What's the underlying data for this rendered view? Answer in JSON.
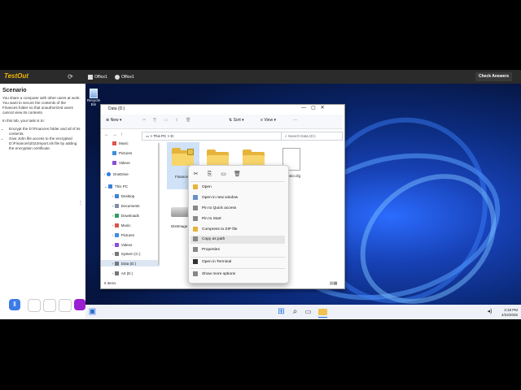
{
  "app": {
    "logo": "TestOut",
    "tabs": [
      {
        "label": "Office1"
      },
      {
        "label": "Office1"
      }
    ],
    "check_answers": "Check Answers"
  },
  "scenario": {
    "title": "Scenario",
    "intro": "You share a computer with other users at work. You want to secure the contents of the Finances folder so that unauthorized users cannot view its contents.",
    "task_lead": "In this lab, your task is to:",
    "tasks": [
      "Encrypt the D:\\Finances folder and all of its contents.",
      "Give John file access to the encrypted D:\\Finances\\2022report.xls file by adding the encryption certificate."
    ]
  },
  "desktop": {
    "recycle_bin": "Recycle Bin"
  },
  "explorer": {
    "title": "Data (D:)",
    "toolbar": {
      "new": "New",
      "sort": "Sort",
      "view": "View",
      "more": "···"
    },
    "address": {
      "root": "This PC",
      "sep": ">",
      "drive": "D:"
    },
    "search_placeholder": "Search Data (D:)",
    "sidebar": [
      {
        "label": "Music",
        "icon": "music-icon",
        "color": "#e0524b"
      },
      {
        "label": "Pictures",
        "icon": "pictures-icon",
        "color": "#3c8fe0"
      },
      {
        "label": "Videos",
        "icon": "videos-icon",
        "color": "#8a4fd8"
      },
      {
        "label": "OneDrive",
        "icon": "onedrive-icon",
        "color": "#2f7de1"
      },
      {
        "label": "This PC",
        "icon": "pc-icon",
        "color": "#3b82d6"
      },
      {
        "label": "Desktop",
        "icon": "desktop-icon",
        "color": "#3b82d6"
      },
      {
        "label": "Documents",
        "icon": "documents-icon",
        "color": "#7d8da6"
      },
      {
        "label": "Downloads",
        "icon": "downloads-icon",
        "color": "#2e9d5b"
      },
      {
        "label": "Music",
        "icon": "music-icon",
        "color": "#e0524b"
      },
      {
        "label": "Pictures",
        "icon": "pictures-icon",
        "color": "#3c8fe0"
      },
      {
        "label": "Videos",
        "icon": "videos-icon",
        "color": "#8a4fd8"
      },
      {
        "label": "System (C:)",
        "icon": "drive-icon",
        "color": "#777777"
      },
      {
        "label": "Data (D:)",
        "icon": "drive-icon",
        "color": "#777777"
      },
      {
        "label": "Art (E:)",
        "icon": "drive-icon",
        "color": "#777777"
      }
    ],
    "items": {
      "finances": "Finances",
      "distimage": "DistImage",
      "text_file": "...stcr.cfg"
    },
    "status": "6 items"
  },
  "context_menu": {
    "quick_actions": [
      "cut-icon",
      "copy-icon",
      "rename-icon",
      "share-icon",
      "delete-icon"
    ],
    "items": [
      {
        "label": "Open"
      },
      {
        "label": "Open in new window"
      },
      {
        "label": "Pin to Quick access"
      },
      {
        "label": "Pin to Start"
      },
      {
        "label": "Compress to ZIP file"
      },
      {
        "label": "Copy as path"
      },
      {
        "label": "Properties"
      },
      {
        "label": "Open in Terminal"
      },
      {
        "label": "Show more options"
      }
    ]
  },
  "taskbar": {
    "time": "3:18 PM",
    "date": "4/24/2025"
  }
}
